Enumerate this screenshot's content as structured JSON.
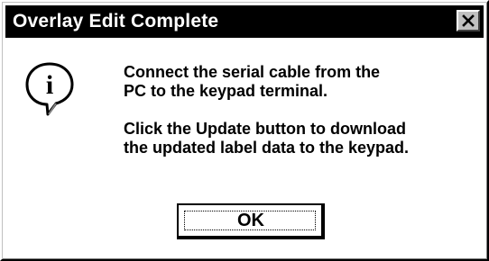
{
  "window": {
    "title": "Overlay Edit Complete",
    "close_icon": "close-x-icon"
  },
  "icon": {
    "name": "information-icon",
    "glyph": "i"
  },
  "message": {
    "line1": "Connect the serial cable from the\nPC to the keypad terminal.",
    "line2": "Click the Update button to download\nthe updated label data to the keypad."
  },
  "buttons": {
    "ok_label": "OK"
  },
  "colors": {
    "titlebar": "#000000",
    "title_text": "#ffffff",
    "background": "#ffffff"
  }
}
